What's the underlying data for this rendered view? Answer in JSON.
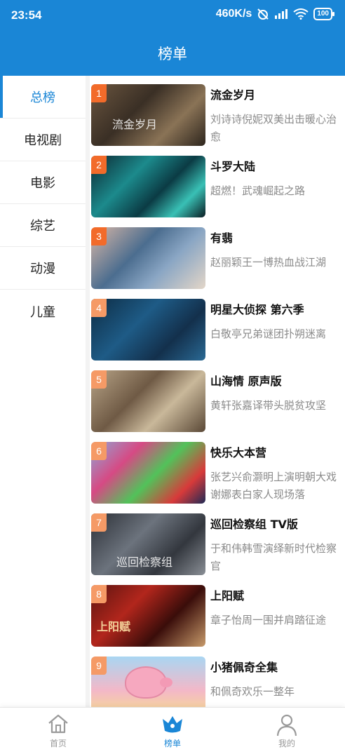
{
  "status": {
    "time": "23:54",
    "speed": "460K/s",
    "battery": "100"
  },
  "header": {
    "title": "榜单"
  },
  "sidebar": {
    "items": [
      {
        "label": "总榜",
        "active": true
      },
      {
        "label": "电视剧",
        "active": false
      },
      {
        "label": "电影",
        "active": false
      },
      {
        "label": "综艺",
        "active": false
      },
      {
        "label": "动漫",
        "active": false
      },
      {
        "label": "儿童",
        "active": false
      }
    ]
  },
  "ranking": [
    {
      "rank": "1",
      "title": "流金岁月",
      "desc": "刘诗诗倪妮双美出击暖心治愈",
      "thumb_caption": "流金岁月"
    },
    {
      "rank": "2",
      "title": "斗罗大陆",
      "desc": "超燃！武魂崛起之路"
    },
    {
      "rank": "3",
      "title": "有翡",
      "desc": "赵丽颖王一博热血战江湖"
    },
    {
      "rank": "4",
      "title": "明星大侦探 第六季",
      "desc": "白敬亭兄弟谜团扑朔迷离"
    },
    {
      "rank": "5",
      "title": "山海情 原声版",
      "desc": "黄轩张嘉译带头脱贫攻坚"
    },
    {
      "rank": "6",
      "title": "快乐大本营",
      "desc": "张艺兴俞灏明上演明朝大戏 谢娜表白家人现场落"
    },
    {
      "rank": "7",
      "title": "巡回检察组 TV版",
      "desc": "于和伟韩雪演绎新时代检察官",
      "thumb_caption": "巡回检察组"
    },
    {
      "rank": "8",
      "title": "上阳赋",
      "desc": "章子怡周一围并肩踏征途",
      "thumb_caption": "上阳赋"
    },
    {
      "rank": "9",
      "title": "小猪佩奇全集",
      "desc": "和佩奇欢乐一整年"
    }
  ],
  "bottom_nav": [
    {
      "label": "首页",
      "icon": "home-icon",
      "active": false
    },
    {
      "label": "榜单",
      "icon": "crown-icon",
      "active": true
    },
    {
      "label": "我的",
      "icon": "user-icon",
      "active": false
    }
  ],
  "colors": {
    "primary": "#1a86d6",
    "rank_badge": "#f26b2a",
    "desc_text": "#8a8a8a"
  }
}
